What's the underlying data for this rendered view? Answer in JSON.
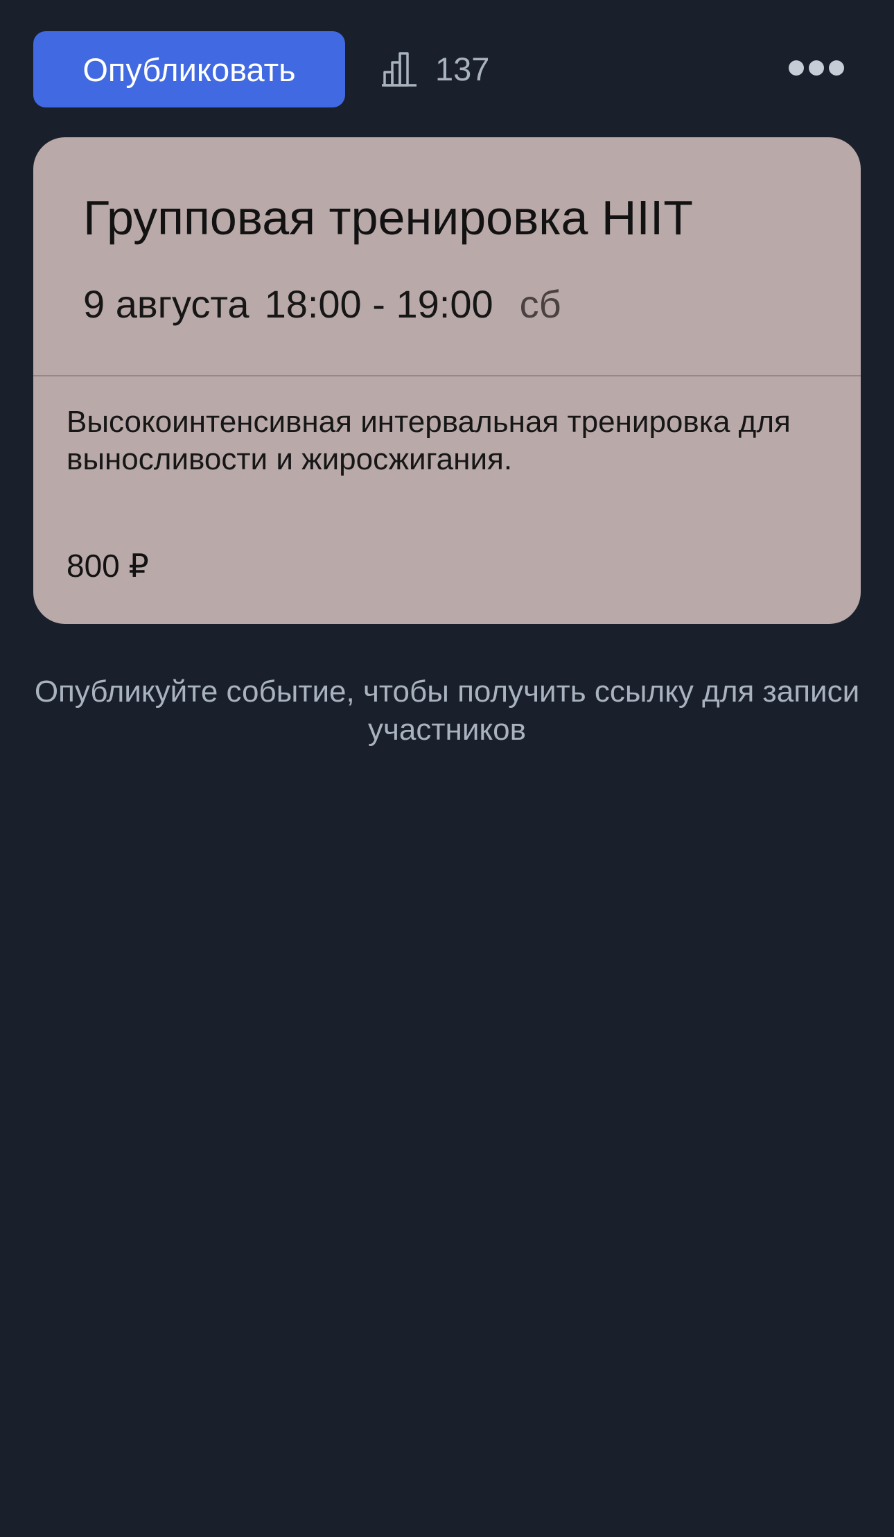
{
  "toolbar": {
    "publish_label": "Опубликовать",
    "stats_icon": "bar-chart-icon",
    "stats_count": "137",
    "more_icon": "more-horizontal-icon"
  },
  "event": {
    "title": "Групповая тренировка HIIT",
    "date": "9 августа",
    "time": "18:00 - 19:00",
    "weekday": "сб",
    "description": "Высокоинтенсивная интервальная тренировка для выносливости и жиросжигания.",
    "price": "800 ₽"
  },
  "hint": {
    "text": "Опубликуйте событие, чтобы получить ссылку для записи участников"
  },
  "colors": {
    "background": "#19202b",
    "accent": "#4169e1",
    "card": "#baa9a9",
    "muted_text": "#a9b2bf"
  }
}
